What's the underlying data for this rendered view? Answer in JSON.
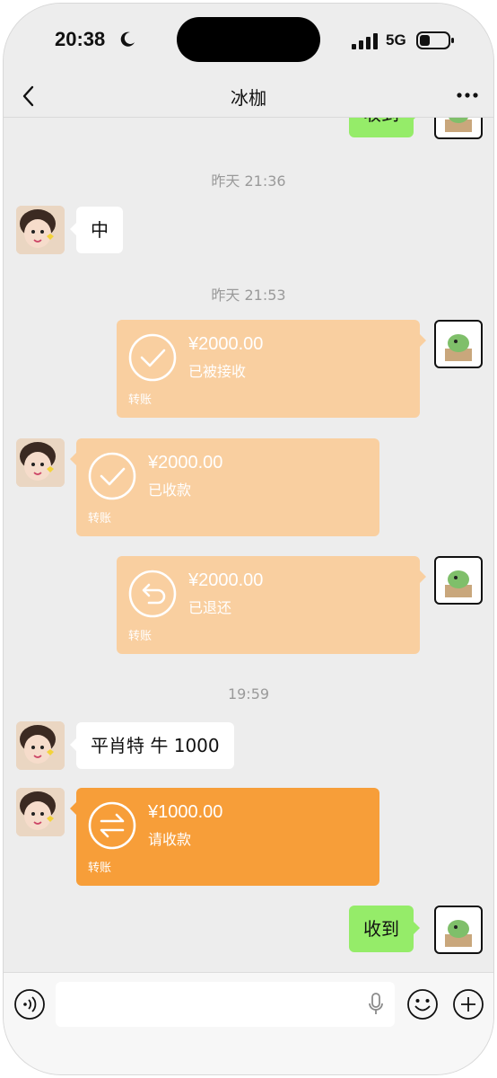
{
  "status_bar": {
    "time": "20:38",
    "network": "5G"
  },
  "header": {
    "title": "冰枷"
  },
  "messages": {
    "top_partial": {
      "text": "收到"
    },
    "ts1": "昨天 21:36",
    "m1": {
      "text": "中"
    },
    "ts2": "昨天 21:53",
    "t1": {
      "amount": "¥2000.00",
      "status": "已被接收",
      "label": "转账"
    },
    "t2": {
      "amount": "¥2000.00",
      "status": "已收款",
      "label": "转账"
    },
    "t3": {
      "amount": "¥2000.00",
      "status": "已退还",
      "label": "转账"
    },
    "ts3": "19:59",
    "m2": {
      "text": "平肖特 牛 1000"
    },
    "t4": {
      "amount": "¥1000.00",
      "status": "请收款",
      "label": "转账"
    },
    "m3": {
      "text": "收到"
    }
  },
  "colors": {
    "transfer_done": "#f9cfa0",
    "transfer_pending": "#f79e39",
    "sent_bubble": "#95ec69"
  },
  "icons": [
    "moon-icon",
    "signal-icon",
    "battery-icon",
    "back-icon",
    "more-icon",
    "check-circle-icon",
    "return-icon",
    "transfer-icon",
    "voice-icon",
    "mic-icon",
    "emoji-icon",
    "plus-icon"
  ]
}
